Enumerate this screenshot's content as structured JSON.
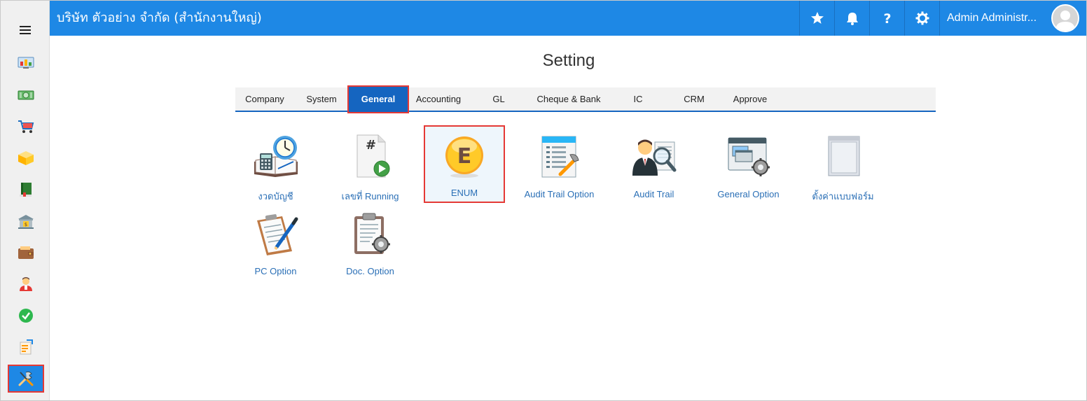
{
  "header": {
    "company": "บริษัท ตัวอย่าง จำกัด (สำนักงานใหญ่)",
    "user_name": "Admin Administr...",
    "icons": [
      "star-icon",
      "bell-icon",
      "help-icon",
      "gear-icon"
    ],
    "color": "#1e88e5"
  },
  "sidebar": {
    "items": [
      {
        "icon": "dashboard-icon"
      },
      {
        "icon": "money-icon"
      },
      {
        "icon": "cart-icon"
      },
      {
        "icon": "box-icon"
      },
      {
        "icon": "book-icon"
      },
      {
        "icon": "bank-icon"
      },
      {
        "icon": "wallet-icon"
      },
      {
        "icon": "person-icon"
      },
      {
        "icon": "check-icon"
      },
      {
        "icon": "report-icon"
      },
      {
        "icon": "tools-icon",
        "active": true
      }
    ]
  },
  "page": {
    "title": "Setting"
  },
  "tabs": [
    {
      "label": "Company"
    },
    {
      "label": "System"
    },
    {
      "label": "General",
      "active": true
    },
    {
      "label": "Accounting"
    },
    {
      "label": "GL"
    },
    {
      "label": "Cheque & Bank"
    },
    {
      "label": "IC"
    },
    {
      "label": "CRM"
    },
    {
      "label": "Approve"
    }
  ],
  "tiles": [
    {
      "label": "งวดบัญชี",
      "icon": "calendar-clock-icon"
    },
    {
      "label": "เลขที่ Running",
      "icon": "running-number-icon"
    },
    {
      "label": "ENUM",
      "icon": "enum-icon",
      "selected": true
    },
    {
      "label": "Audit Trail Option",
      "icon": "audit-option-icon"
    },
    {
      "label": "Audit Trail",
      "icon": "audit-trail-icon"
    },
    {
      "label": "General Option",
      "icon": "general-option-icon"
    },
    {
      "label": "ตั้งค่าแบบฟอร์ม",
      "icon": "form-setting-icon"
    },
    {
      "label": "PC Option",
      "icon": "pc-option-icon"
    },
    {
      "label": "Doc. Option",
      "icon": "doc-option-icon"
    }
  ]
}
